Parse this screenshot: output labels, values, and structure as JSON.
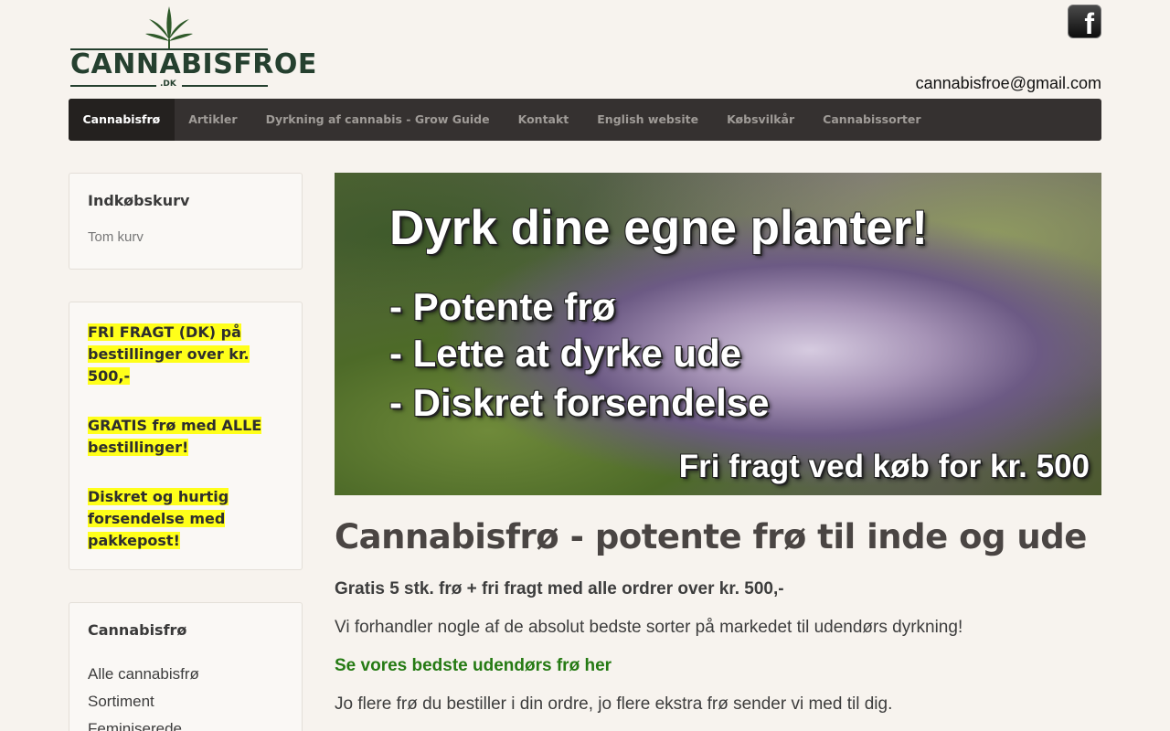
{
  "header": {
    "logo_text": "CANNABISFROE",
    "logo_tld": ".DK",
    "facebook_icon": "facebook-icon",
    "facebook_glyph": "f",
    "email": "cannabisfroe@gmail.com"
  },
  "nav": {
    "items": [
      {
        "label": "Cannabisfrø",
        "active": true
      },
      {
        "label": "Artikler"
      },
      {
        "label": "Dyrkning af cannabis - Grow Guide"
      },
      {
        "label": "Kontakt"
      },
      {
        "label": "English website"
      },
      {
        "label": "Købsvilkår"
      },
      {
        "label": "Cannabissorter"
      }
    ]
  },
  "sidebar": {
    "cart": {
      "title": "Indkøbskurv",
      "empty_text": "Tom kurv"
    },
    "promos": [
      "FRI FRAGT (DK) på bestillinger over kr. 500,-",
      "GRATIS frø med ALLE bestillinger!",
      "Diskret og hurtig forsendelse med pakkepost!"
    ],
    "seeds": {
      "title": "Cannabisfrø",
      "links": [
        "Alle cannabisfrø",
        "Sortiment",
        "Feminiserede"
      ]
    }
  },
  "banner": {
    "headline": "Dyrk dine egne planter!",
    "points": [
      "- Potente frø",
      "- Lette at dyrke ude",
      "- Diskret forsendelse"
    ],
    "footer": "Fri fragt ved køb for kr. 500"
  },
  "main": {
    "title": "Cannabisfrø - potente frø til inde og ude",
    "bold_line": "Gratis 5 stk. frø + fri fragt med alle ordrer over kr. 500,-",
    "line2": "Vi forhandler nogle af de absolut bedste sorter på markedet til udendørs dyrkning!",
    "link": "Se vores bedste udendørs frø her",
    "line4": "Jo flere frø du bestiller i din ordre, jo flere ekstra frø sender vi med til dig."
  },
  "colors": {
    "nav_bg": "#353130",
    "nav_active": "#24211f",
    "highlight": "#ffff1a",
    "link_green": "#257a13",
    "page_bg": "#f7f3ee"
  }
}
